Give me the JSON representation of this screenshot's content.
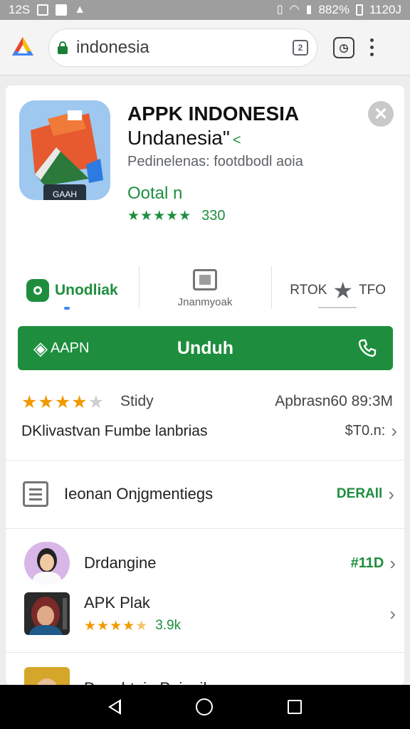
{
  "status_bar": {
    "left_text": "12S",
    "battery": "882%",
    "time": "1120J"
  },
  "browser": {
    "url": "indonesia",
    "tab_count": "2"
  },
  "app": {
    "title": "APPK INDONESIA",
    "subtitle": "Undanesia\"",
    "subtitle_mark": "˂",
    "developer": "Pedinelenas: footdbodl aoia",
    "category": "Ootal n",
    "rating_stars": "★★★★★",
    "rating_count": "330",
    "icon_label": "GAAH"
  },
  "tabs": [
    {
      "label": "Unodliak"
    },
    {
      "label": "Jnanmyoak"
    },
    {
      "label": "RTOK",
      "label2": "TFO"
    }
  ],
  "install_button": {
    "left_label": "AAPN",
    "label": "Unduh"
  },
  "rating_section": {
    "stars": 4,
    "study": "Stidy",
    "approx": "Apbrasn60 89:3M",
    "description": "DKlivastvan Fumbe lanbrias",
    "price": "$T0.n:"
  },
  "document_row": {
    "label": "Ieonan Onjgmentiegs",
    "detail": "DERAll"
  },
  "list": [
    {
      "name": "Drdangine",
      "value": "#11D"
    },
    {
      "name": "APK Plak",
      "stars": "★★★★",
      "half": "★",
      "count": "3.9k"
    },
    {
      "name": "Dnenhtaia Paianibans"
    }
  ],
  "colors": {
    "accent_green": "#1e8e3e",
    "star_orange": "#f29900"
  }
}
